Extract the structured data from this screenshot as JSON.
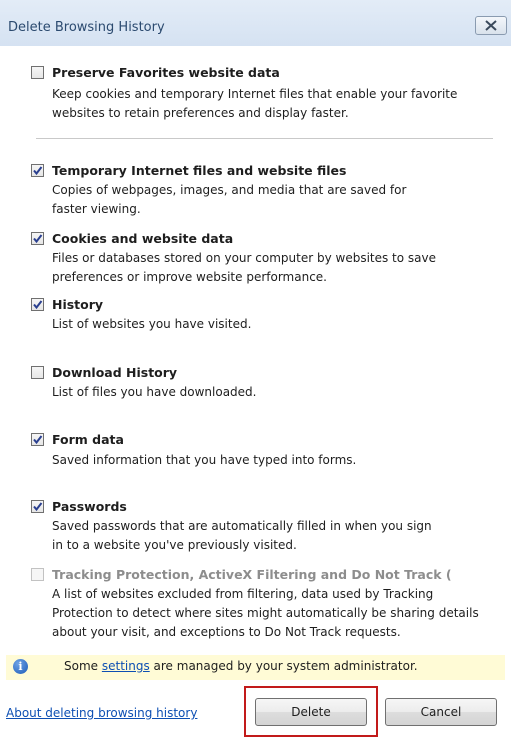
{
  "dialog": {
    "title": "Delete Browsing History",
    "close_label": "close"
  },
  "options": [
    {
      "title": "Preserve Favorites website data",
      "desc": [
        "Keep cookies and temporary Internet files that enable your favorite",
        "websites to retain preferences and display faster."
      ],
      "checked": false,
      "disabled": false
    },
    {
      "title": "Temporary Internet files and website files",
      "desc": [
        "Copies of webpages, images, and media that are saved for",
        "faster viewing."
      ],
      "checked": true,
      "disabled": false
    },
    {
      "title": "Cookies and website data",
      "desc": [
        "Files or databases stored on your computer by websites to save",
        "preferences or improve website performance."
      ],
      "checked": true,
      "disabled": false
    },
    {
      "title": "History",
      "desc": [
        "List of websites you have visited."
      ],
      "checked": true,
      "disabled": false
    },
    {
      "title": "Download History",
      "desc": [
        "List of files you have downloaded."
      ],
      "checked": false,
      "disabled": false
    },
    {
      "title": "Form data",
      "desc": [
        "Saved information that you have typed into forms."
      ],
      "checked": true,
      "disabled": false
    },
    {
      "title": "Passwords",
      "desc": [
        "Saved passwords that are automatically filled in when you sign",
        "in to a website you've previously visited."
      ],
      "checked": true,
      "disabled": false
    },
    {
      "title": "Tracking Protection, ActiveX Filtering and Do Not Track (",
      "desc": [
        "A list of websites excluded from filtering, data used by Tracking",
        "Protection to detect where sites might automatically be sharing details",
        "about your visit, and exceptions to Do Not Track requests."
      ],
      "checked": false,
      "disabled": true
    }
  ],
  "info": {
    "prefix": "Some ",
    "link": "settings",
    "suffix": " are managed by your system administrator."
  },
  "footer": {
    "about_link": "About deleting browsing history",
    "delete_label": "Delete",
    "cancel_label": "Cancel"
  },
  "colors": {
    "highlight": "#c21a1a",
    "link": "#0d4fb3",
    "info_bg": "#fffbd6"
  }
}
